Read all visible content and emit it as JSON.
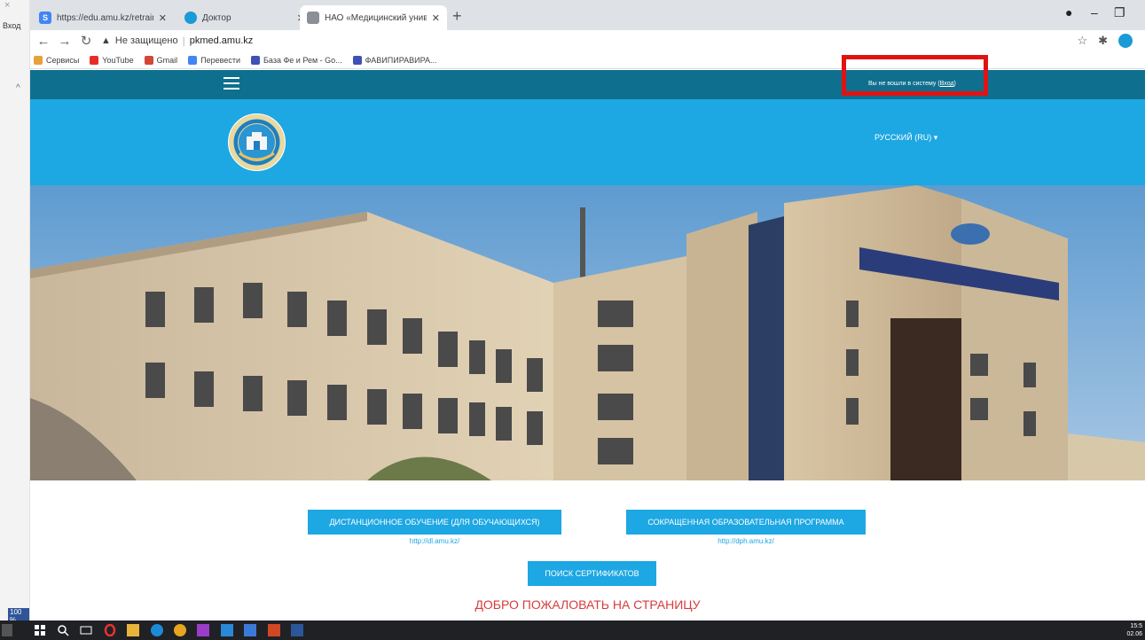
{
  "outer_left": {
    "close_glyph": "×",
    "label": "Вход",
    "zoom": "100 %"
  },
  "browser": {
    "tabs": [
      {
        "title": "https://edu.amu.kz/retraining/in",
        "icon": "s-icon",
        "color": "#4285f4"
      },
      {
        "title": "Доктор",
        "icon": "chrome-icon",
        "color": "#1a9ad6"
      },
      {
        "title": "НАО «Медицинский университ",
        "icon": "university-icon",
        "color": "#8a8f98"
      }
    ],
    "address": {
      "warning": "Не защищено",
      "url": "pkmed.amu.kz"
    },
    "bookmarks": [
      {
        "label": "Сервисы",
        "color": "#e8a03a"
      },
      {
        "label": "YouTube",
        "color": "#e52d27"
      },
      {
        "label": "Gmail",
        "color": "#d44638"
      },
      {
        "label": "Перевести",
        "color": "#4285f4"
      },
      {
        "label": "База Фе и Рем - Go...",
        "color": "#3f51b5"
      },
      {
        "label": "ФАВИПИРАВИРА...",
        "color": "#3f51b5"
      }
    ]
  },
  "site": {
    "nav": {
      "status_text": "Вы не вошли в систему (",
      "login_link": "Вход",
      "status_end": ")"
    },
    "header": {
      "language": "РУССКИЙ (RU) ▾"
    },
    "buttons": {
      "distance": "ДИСТАНЦИОННОЕ ОБУЧЕНИЕ (ДЛЯ ОБУЧАЮЩИХСЯ)",
      "distance_url": "http://dl.amu.kz/",
      "short": "СОКРАЩЕННАЯ ОБРАЗОВАТЕЛЬНАЯ ПРОГРАММА",
      "short_url": "http://dph.amu.kz/",
      "certs": "ПОИСК СЕРТИФИКАТОВ"
    },
    "welcome": "ДОБРО ПОЖАЛОВАТЬ НА СТРАНИЦУ"
  },
  "taskbar": {
    "time": "15:5",
    "date": "02.06"
  }
}
